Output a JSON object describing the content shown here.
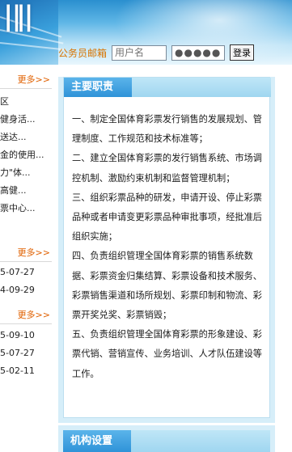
{
  "login": {
    "label": "公务员邮箱",
    "username_placeholder": "用户名",
    "password_value": "●●●●●●",
    "submit_label": "登录"
  },
  "left": {
    "more_label": "更多>>",
    "box1_items": [
      "区",
      "健身活...",
      "送达...",
      "金的使用...",
      "力\"体...",
      "高健...",
      "票中心..."
    ],
    "box2_items": [
      "5-07-27",
      "4-09-29"
    ],
    "box3_items": [
      "5-09-10",
      "5-07-27",
      "5-02-11"
    ]
  },
  "main": {
    "duties_title": "主要职责",
    "duties": [
      "一、制定全国体育彩票发行销售的发展规划、管理制度、工作规范和技术标准等；",
      "二、建立全国体育彩票的发行销售系统、市场调控机制、激励约束机制和监督管理机制；",
      "三、组织彩票品种的研发，申请开设、停止彩票品种或者申请变更彩票品种审批事项，经批准后组织实施；",
      "四、负责组织管理全国体育彩票的销售系统数据、彩票资金归集结算、彩票设备和技术服务、彩票销售渠道和场所规划、彩票印制和物流、彩票开奖兑奖、彩票销毁；",
      "五、负责组织管理全国体育彩票的形象建设、彩票代销、营销宣传、业务培训、人才队伍建设等工作。"
    ],
    "org_title": "机构设置"
  },
  "colors": {
    "accent_orange": "#e06000",
    "tab_blue": "#2f93d8",
    "panel_bg": "#d6eef9"
  }
}
